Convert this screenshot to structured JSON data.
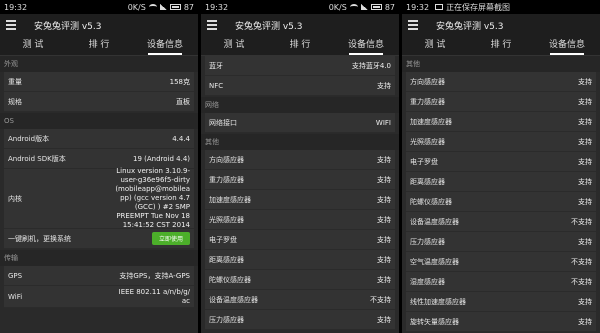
{
  "status": {
    "left": {
      "time": "19:32",
      "speed": "0K/S",
      "battery": "87"
    },
    "middle": {
      "time": "19:32",
      "speed": "0K/S",
      "battery": "87"
    },
    "right": {
      "time": "19:32",
      "saving_text": "正在保存屏幕截图"
    }
  },
  "app_title": "安兔兔评测 v5.3",
  "tabs": [
    "测 试",
    "排 行",
    "设备信息"
  ],
  "left": {
    "appearance_header": "外观",
    "appearance": [
      {
        "label": "重量",
        "value": "158克"
      },
      {
        "label": "规格",
        "value": "直板"
      }
    ],
    "os_header": "OS",
    "os": [
      {
        "label": "Android版本",
        "value": "4.4.4"
      },
      {
        "label": "Android SDK版本",
        "value": "19 (Android 4.4)"
      }
    ],
    "kernel_label": "内核",
    "kernel_value": "Linux version 3.10.9-\nuser-g36e96f5-dirty\n(mobileapp@mobilea\npp) (gcc version 4.7\n(GCC) ) #2 SMP\nPREEMPT Tue Nov 18\n15:41:52 CST 2014",
    "root_label": "一键刷机，更换系统",
    "root_button": "立即使用",
    "transfer_header": "传输",
    "transfer": [
      {
        "label": "GPS",
        "value": "支持GPS，支持A-GPS"
      },
      {
        "label": "WiFi",
        "value": "IEEE 802.11 a/n/b/g/\nac"
      }
    ]
  },
  "middle": {
    "bt": [
      {
        "label": "蓝牙",
        "value": "支持蓝牙4.0"
      },
      {
        "label": "NFC",
        "value": "支持"
      }
    ],
    "network_header": "网络",
    "network": [
      {
        "label": "网络接口",
        "value": "WIFI"
      }
    ],
    "other_header": "其他",
    "sensors": [
      {
        "label": "方向感应器",
        "value": "支持"
      },
      {
        "label": "重力感应器",
        "value": "支持"
      },
      {
        "label": "加速度感应器",
        "value": "支持"
      },
      {
        "label": "光照感应器",
        "value": "支持"
      },
      {
        "label": "电子罗盘",
        "value": "支持"
      },
      {
        "label": "距离感应器",
        "value": "支持"
      },
      {
        "label": "陀螺仪感应器",
        "value": "支持"
      },
      {
        "label": "设备温度感应器",
        "value": "不支持"
      },
      {
        "label": "压力感应器",
        "value": "支持"
      }
    ]
  },
  "right": {
    "other_header": "其他",
    "sensors": [
      {
        "label": "方向感应器",
        "value": "支持"
      },
      {
        "label": "重力感应器",
        "value": "支持"
      },
      {
        "label": "加速度感应器",
        "value": "支持"
      },
      {
        "label": "光照感应器",
        "value": "支持"
      },
      {
        "label": "电子罗盘",
        "value": "支持"
      },
      {
        "label": "距离感应器",
        "value": "支持"
      },
      {
        "label": "陀螺仪感应器",
        "value": "支持"
      },
      {
        "label": "设备温度感应器",
        "value": "不支持"
      },
      {
        "label": "压力感应器",
        "value": "支持"
      },
      {
        "label": "空气温度感应器",
        "value": "不支持"
      },
      {
        "label": "湿度感应器",
        "value": "不支持"
      },
      {
        "label": "线性加速度感应器",
        "value": "支持"
      },
      {
        "label": "旋转矢量感应器",
        "value": "支持"
      }
    ]
  },
  "colors": {
    "accent_button": "#4caf2a",
    "background": "#2a2a2a",
    "card": "#333333"
  }
}
